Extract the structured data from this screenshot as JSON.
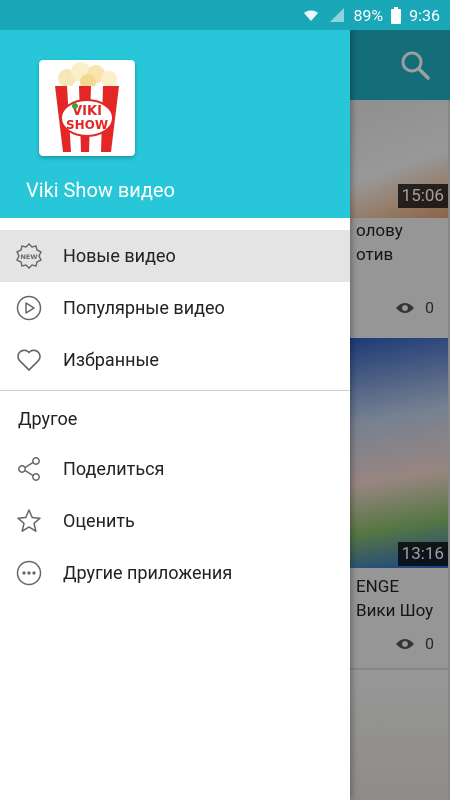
{
  "status_bar": {
    "battery": "89%",
    "time": "9:36"
  },
  "drawer": {
    "header_title": "Viki Show видео",
    "logo_text": [
      "VIKI",
      "SHOW"
    ],
    "items": [
      {
        "label": "Новые видео",
        "icon": "new-badge-icon",
        "active": true
      },
      {
        "label": "Популярные видео",
        "icon": "play-circle-icon",
        "active": false
      },
      {
        "label": "Избранные",
        "icon": "heart-icon",
        "active": false
      }
    ],
    "section_other": "Другое",
    "other_items": [
      {
        "label": "Поделиться",
        "icon": "share-icon"
      },
      {
        "label": "Оценить",
        "icon": "star-icon"
      },
      {
        "label": "Другие приложения",
        "icon": "more-horiz-icon"
      }
    ]
  },
  "background": {
    "videos": [
      {
        "duration": "15:06",
        "title_line1": "олову",
        "title_line2": "отив",
        "views": "0"
      },
      {
        "duration": "13:16",
        "title_line1": "ENGE",
        "title_line2": "Вики Шоу",
        "views": "0"
      }
    ]
  },
  "colors": {
    "status_bar": "#1aa8b8",
    "toolbar": "#1fb2c3",
    "drawer_header": "#27c7d9",
    "logo_red": "#e32727"
  }
}
